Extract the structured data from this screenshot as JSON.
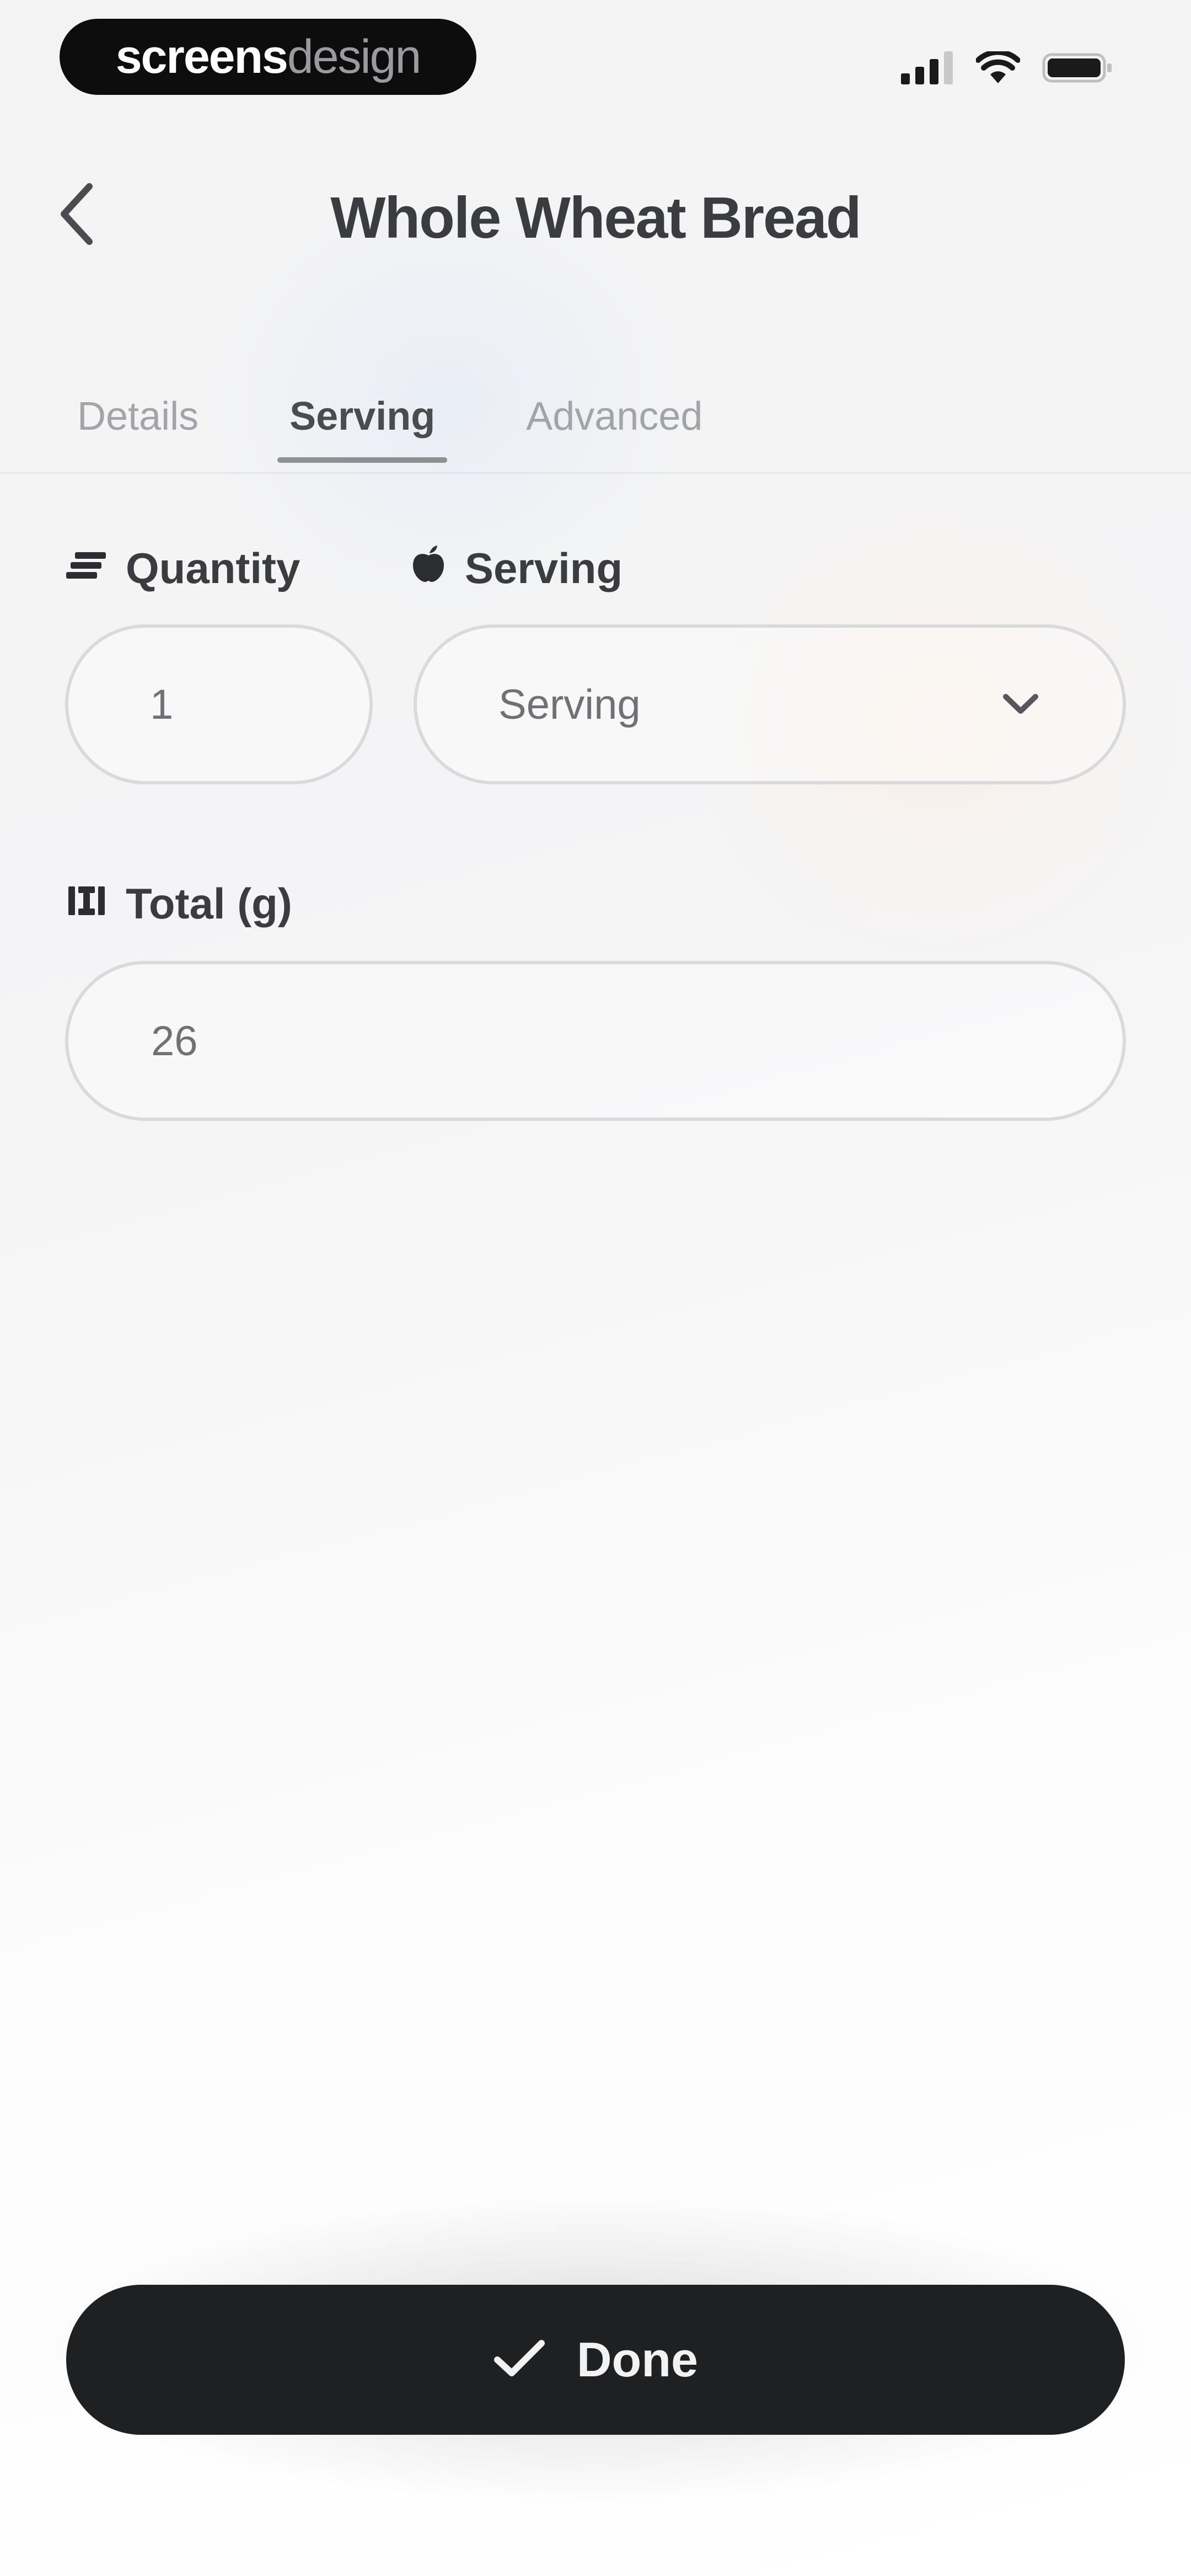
{
  "status_bar": {
    "brand_part1": "screens",
    "brand_part2": "design",
    "icons": [
      "cellular-signal-icon",
      "wifi-icon",
      "battery-icon"
    ]
  },
  "header": {
    "title": "Whole Wheat Bread",
    "back_icon": "chevron-left-icon"
  },
  "tabs": [
    {
      "label": "Details",
      "active": false
    },
    {
      "label": "Serving",
      "active": true
    },
    {
      "label": "Advanced",
      "active": false
    }
  ],
  "fields": {
    "quantity": {
      "label": "Quantity",
      "icon": "stack-icon",
      "value": "1"
    },
    "serving": {
      "label": "Serving",
      "icon": "apple-icon",
      "selected": "Serving",
      "dropdown_icon": "chevron-down-icon"
    },
    "total": {
      "label": "Total (g)",
      "icon": "scale-icon",
      "value": "26"
    }
  },
  "done_button": {
    "label": "Done",
    "icon": "checkmark-icon"
  },
  "colors": {
    "background": "#f4f4f5",
    "text_primary": "#3a3c3f",
    "text_muted": "#a2a4a8",
    "input_border": "#dadadd",
    "button_bg": "#1e2022",
    "button_text": "#f2f2f2"
  }
}
